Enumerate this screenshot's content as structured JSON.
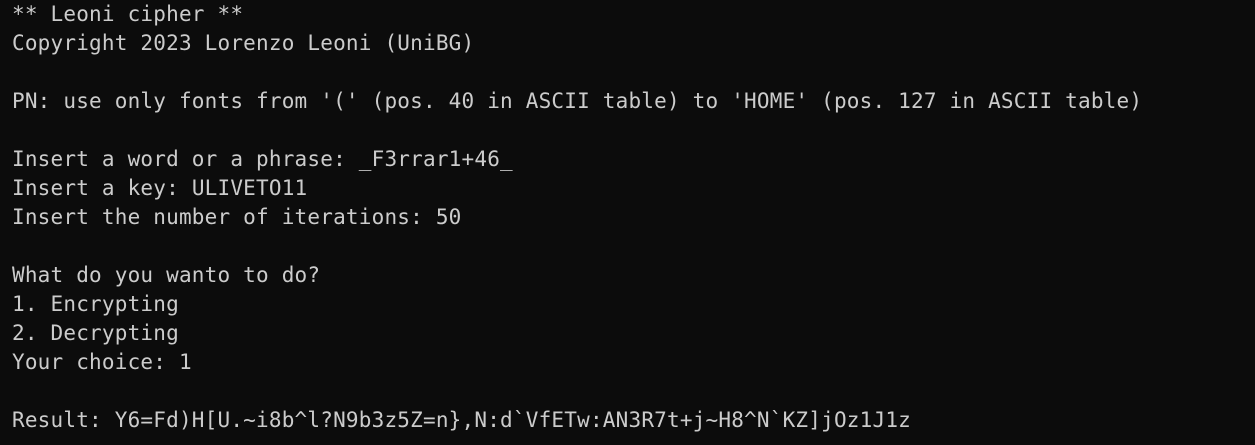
{
  "terminal": {
    "background": "#0c0c0c",
    "foreground": "#cccccc",
    "header_title": "** Leoni cipher **",
    "copyright": "Copyright 2023 Lorenzo Leoni (UniBG)",
    "note": "PN: use only fonts from '(' (pos. 40 in ASCII table) to 'HOME' (pos. 127 in ASCII table)",
    "prompts": {
      "phrase_label": "Insert a word or a phrase: ",
      "phrase_value": "_F3rrar1+46_",
      "key_label": "Insert a key: ",
      "key_value": "ULIVETO11",
      "iterations_label": "Insert the number of iterations: ",
      "iterations_value": "50"
    },
    "menu": {
      "question": "What do you wanto to do?",
      "option_1": "1. Encrypting",
      "option_2": "2. Decrypting",
      "choice_label": "Your choice: ",
      "choice_value": "1"
    },
    "result_label": "Result: ",
    "result_value": "Y6=Fd)H[U.~i8b^l?N9b3z5Z=n},N:d`VfETw:AN3R7t+j~H8^N`KZ]jOz1J1z"
  }
}
